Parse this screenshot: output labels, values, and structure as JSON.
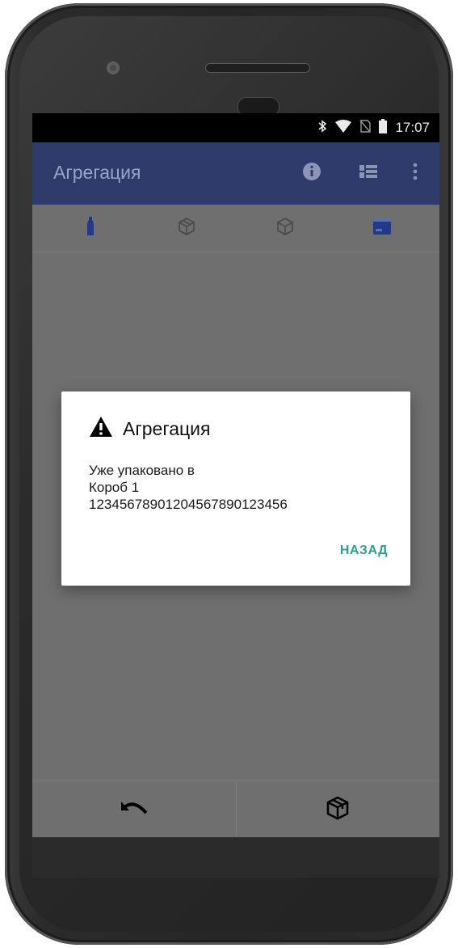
{
  "status_bar": {
    "time": "17:07",
    "icons": [
      "bluetooth-icon",
      "wifi-icon",
      "no-sim-icon",
      "battery-icon"
    ]
  },
  "app_bar": {
    "title": "Агрегация",
    "actions": [
      "info-icon",
      "view-list-icon",
      "overflow-menu-icon"
    ],
    "color": "#2e3a6a"
  },
  "tabs": [
    {
      "icon": "bottle-icon",
      "active": true
    },
    {
      "icon": "package-icon",
      "active": false
    },
    {
      "icon": "box-icon",
      "active": false
    },
    {
      "icon": "container-icon",
      "active": true
    }
  ],
  "dialog": {
    "title": "Агрегация",
    "message_lines": [
      "Уже упаковано в",
      "Короб 1",
      "12345678901204567890123456"
    ],
    "button_label": "НАЗАД",
    "accent_color": "#2a9d96"
  },
  "bottom_bar": {
    "actions": [
      "undo-icon",
      "pack-box-icon"
    ]
  }
}
